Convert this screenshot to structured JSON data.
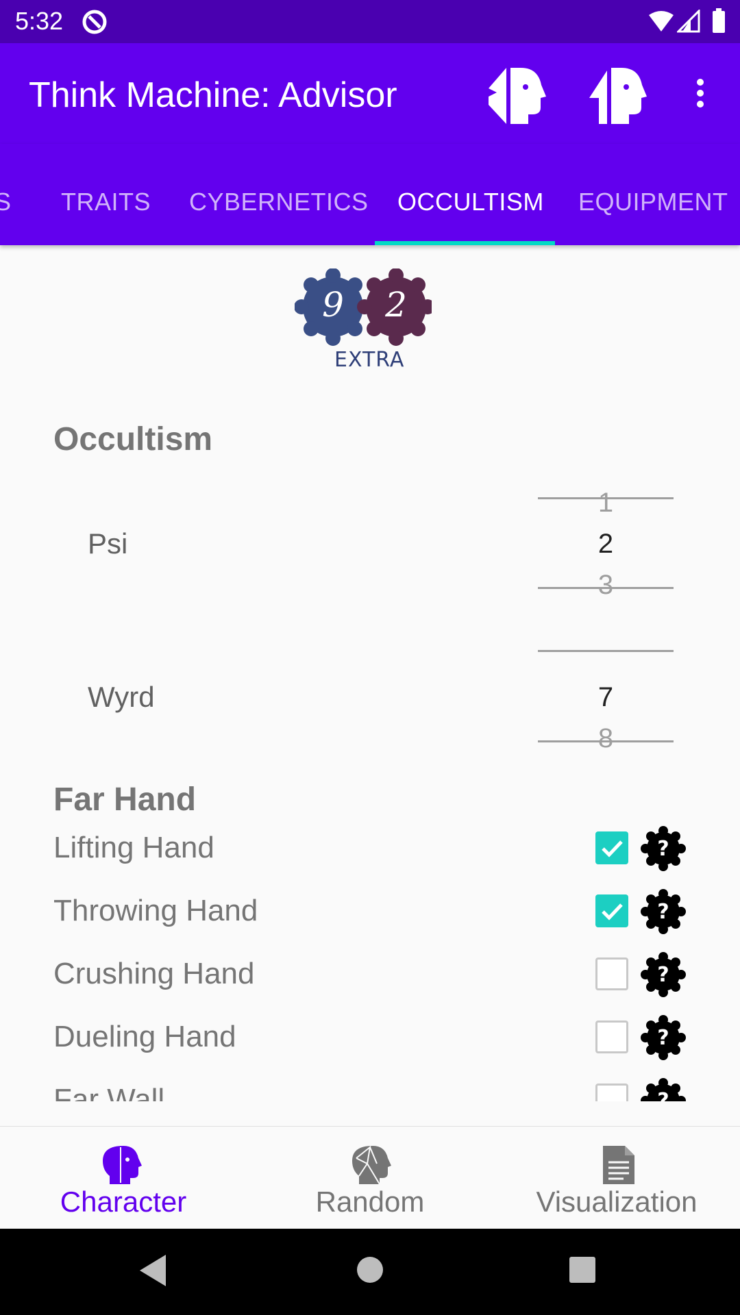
{
  "status": {
    "time": "5:32"
  },
  "app": {
    "title": "Think Machine: Advisor"
  },
  "tabs": [
    {
      "label": "S"
    },
    {
      "label": "TRAITS"
    },
    {
      "label": "CYBERNETICS"
    },
    {
      "label": "OCCULTISM",
      "active": true
    },
    {
      "label": "EQUIPMENT"
    }
  ],
  "badge": {
    "left_value": "9",
    "right_value": "2",
    "label": "EXTRA",
    "left_color": "#3a4f86",
    "right_color": "#5a2a4d"
  },
  "occultism": {
    "title": "Occultism",
    "psi": {
      "label": "Psi",
      "prev": "1",
      "value": "2",
      "next": "3"
    },
    "wyrd": {
      "label": "Wyrd",
      "prev": "",
      "value": "7",
      "next": "8"
    }
  },
  "far_hand": {
    "title": "Far Hand",
    "powers": [
      {
        "label": "Lifting Hand",
        "checked": true
      },
      {
        "label": "Throwing Hand",
        "checked": true
      },
      {
        "label": "Crushing Hand",
        "checked": false
      },
      {
        "label": "Dueling Hand",
        "checked": false
      },
      {
        "label": "Far Wall",
        "checked": false
      }
    ]
  },
  "bottom_nav": [
    {
      "label": "Character",
      "icon": "head-icon",
      "active": true
    },
    {
      "label": "Random",
      "icon": "random-head-icon"
    },
    {
      "label": "Visualization",
      "icon": "document-icon"
    }
  ],
  "colors": {
    "primary": "#6200ee",
    "primary_dark": "#4a00b0",
    "accent": "#03dac5",
    "checkbox": "#1ccfc2"
  }
}
